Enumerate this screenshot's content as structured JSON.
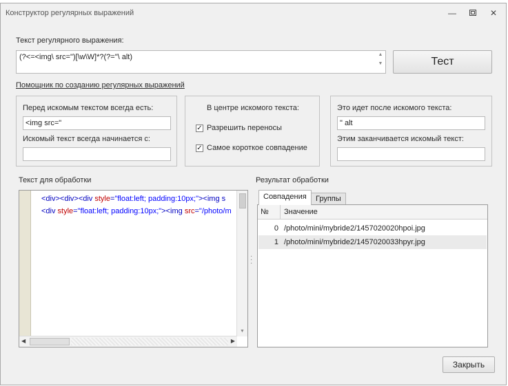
{
  "window": {
    "title": "Конструктор регулярных выражений",
    "minimize_icon": "minimize-icon",
    "maximize_icon": "maximize-icon",
    "close_icon": "close-icon"
  },
  "regex": {
    "label": "Текст регулярного выражения:",
    "value": "(?<=<img\\ src=\")[\\w\\W]*?(?=\"\\ alt)",
    "test_button": "Тест",
    "helper_link": "Помощник по созданию регулярных выражений"
  },
  "before": {
    "label": "Перед искомым текстом всегда есть:",
    "value": "<img src=\"",
    "starts_label": "Искомый текст всегда начинается с:",
    "starts_value": ""
  },
  "center": {
    "label": "В центре искомого текста:",
    "allow_wrap": "Разрешить переносы",
    "allow_wrap_checked": true,
    "shortest": "Самое короткое совпадение",
    "shortest_checked": true
  },
  "after": {
    "label": "Это идет после искомого текста:",
    "value": "\" alt",
    "ends_label": "Этим заканчивается искомый текст:",
    "ends_value": ""
  },
  "input_text": {
    "label": "Текст для обработки",
    "line1": {
      "t1": "<div><div><div ",
      "a1": "style",
      "eq": "=",
      "v1": "\"float:left; padding:10px;\"",
      "t2": "><img s"
    },
    "line2": {
      "t1": "<div ",
      "a1": "style",
      "eq": "=",
      "v1": "\"float:left; padding:10px;\"",
      "t2": "><img ",
      "a2": "src",
      "eq2": "=",
      "v2": "\"/photo/m"
    }
  },
  "result": {
    "label": "Результат обработки",
    "tabs": [
      "Совпадения",
      "Группы"
    ],
    "columns": [
      "№",
      "Значение"
    ],
    "rows": [
      {
        "num": "0",
        "value": "/photo/mini/mybride2/1457020020hpoi.jpg"
      },
      {
        "num": "1",
        "value": "/photo/mini/mybride2/1457020033hpyr.jpg"
      }
    ]
  },
  "close_button": "Закрыть"
}
